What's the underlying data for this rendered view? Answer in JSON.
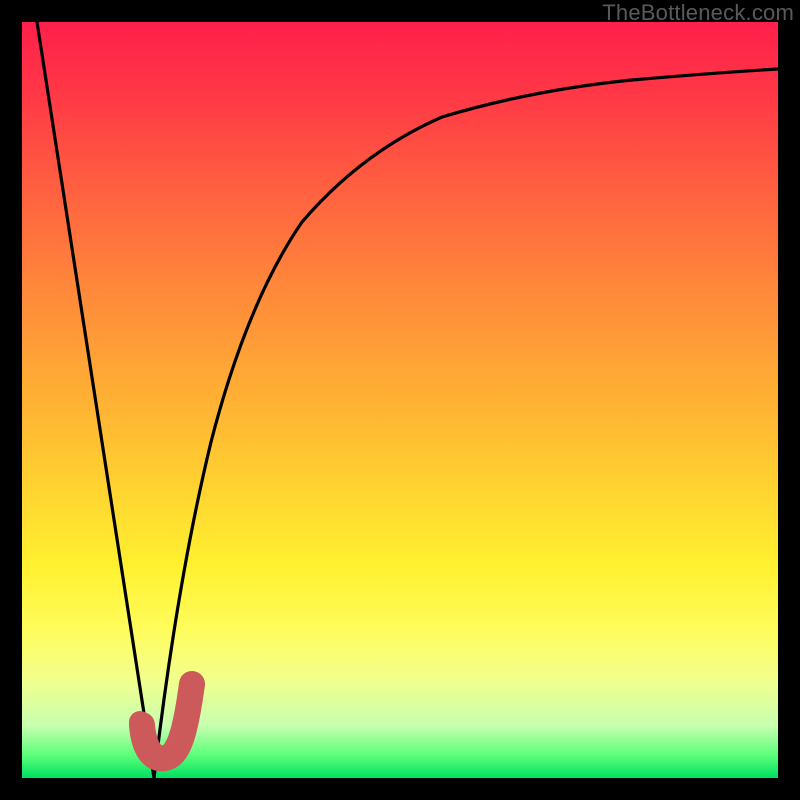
{
  "watermark": "TheBottleneck.com",
  "chart_data": {
    "type": "line",
    "title": "",
    "xlabel": "",
    "ylabel": "",
    "xlim": [
      0,
      100
    ],
    "ylim": [
      0,
      100
    ],
    "legend": false,
    "grid": false,
    "series": [
      {
        "name": "left-line",
        "x": [
          2,
          17.5
        ],
        "values": [
          100,
          0
        ]
      },
      {
        "name": "right-curve",
        "x": [
          17.5,
          20,
          25,
          30,
          35,
          40,
          50,
          60,
          70,
          80,
          90,
          100
        ],
        "values": [
          0,
          20,
          45,
          59,
          67,
          73,
          80,
          84.5,
          87.5,
          89.8,
          91.4,
          92.8
        ]
      }
    ],
    "markers": [
      {
        "name": "dot",
        "x": 15.8,
        "y": 7,
        "color": "#cc5a5a",
        "r": 1.4
      },
      {
        "name": "hook",
        "path": [
          {
            "x": 15.8,
            "y": 7
          },
          {
            "x": 16.4,
            "y": 2.7
          },
          {
            "x": 18.5,
            "y": 2.3
          },
          {
            "x": 20.6,
            "y": 4.8
          },
          {
            "x": 22.4,
            "y": 12.5
          }
        ],
        "color": "#cc5a5a",
        "width": 3.4
      }
    ],
    "background_gradient": [
      {
        "stop": 0,
        "color": "#ff1f4b"
      },
      {
        "stop": 50,
        "color": "#ffb134"
      },
      {
        "stop": 80,
        "color": "#fffc5a"
      },
      {
        "stop": 100,
        "color": "#00e060"
      }
    ]
  }
}
